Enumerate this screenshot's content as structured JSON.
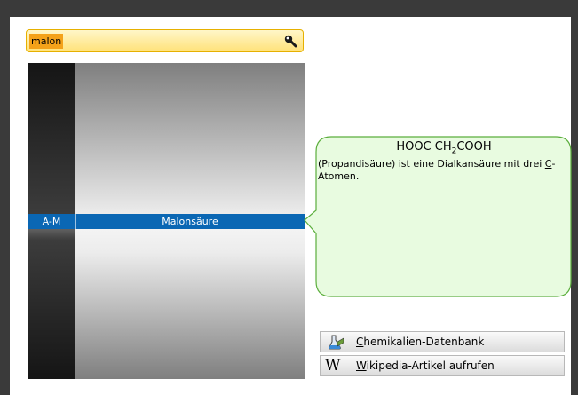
{
  "search": {
    "value": "malon"
  },
  "list": {
    "selected_index": "A-M",
    "selected_name": "Malonsäure"
  },
  "info": {
    "formula_parts": [
      "HOOC CH",
      "2",
      "COOH"
    ],
    "description_before": "(Propandisäure) ist eine Dialkansäure mit drei ",
    "description_link": "C",
    "description_after": "-Atomen."
  },
  "buttons": {
    "chem_db_accel": "C",
    "chem_db_rest": "hemikalien-Datenbank",
    "wikipedia_accel": "W",
    "wikipedia_rest": "ikipedia-Artikel aufrufen",
    "wikipedia_icon_glyph": "W"
  },
  "colors": {
    "selection": "#0a67b4",
    "callout_fill": "#e8fbe0",
    "callout_border": "#5bae3c",
    "search_highlight": "#f4a21a"
  },
  "icons": [
    "search-icon",
    "chemical-database-icon",
    "wikipedia-icon"
  ]
}
